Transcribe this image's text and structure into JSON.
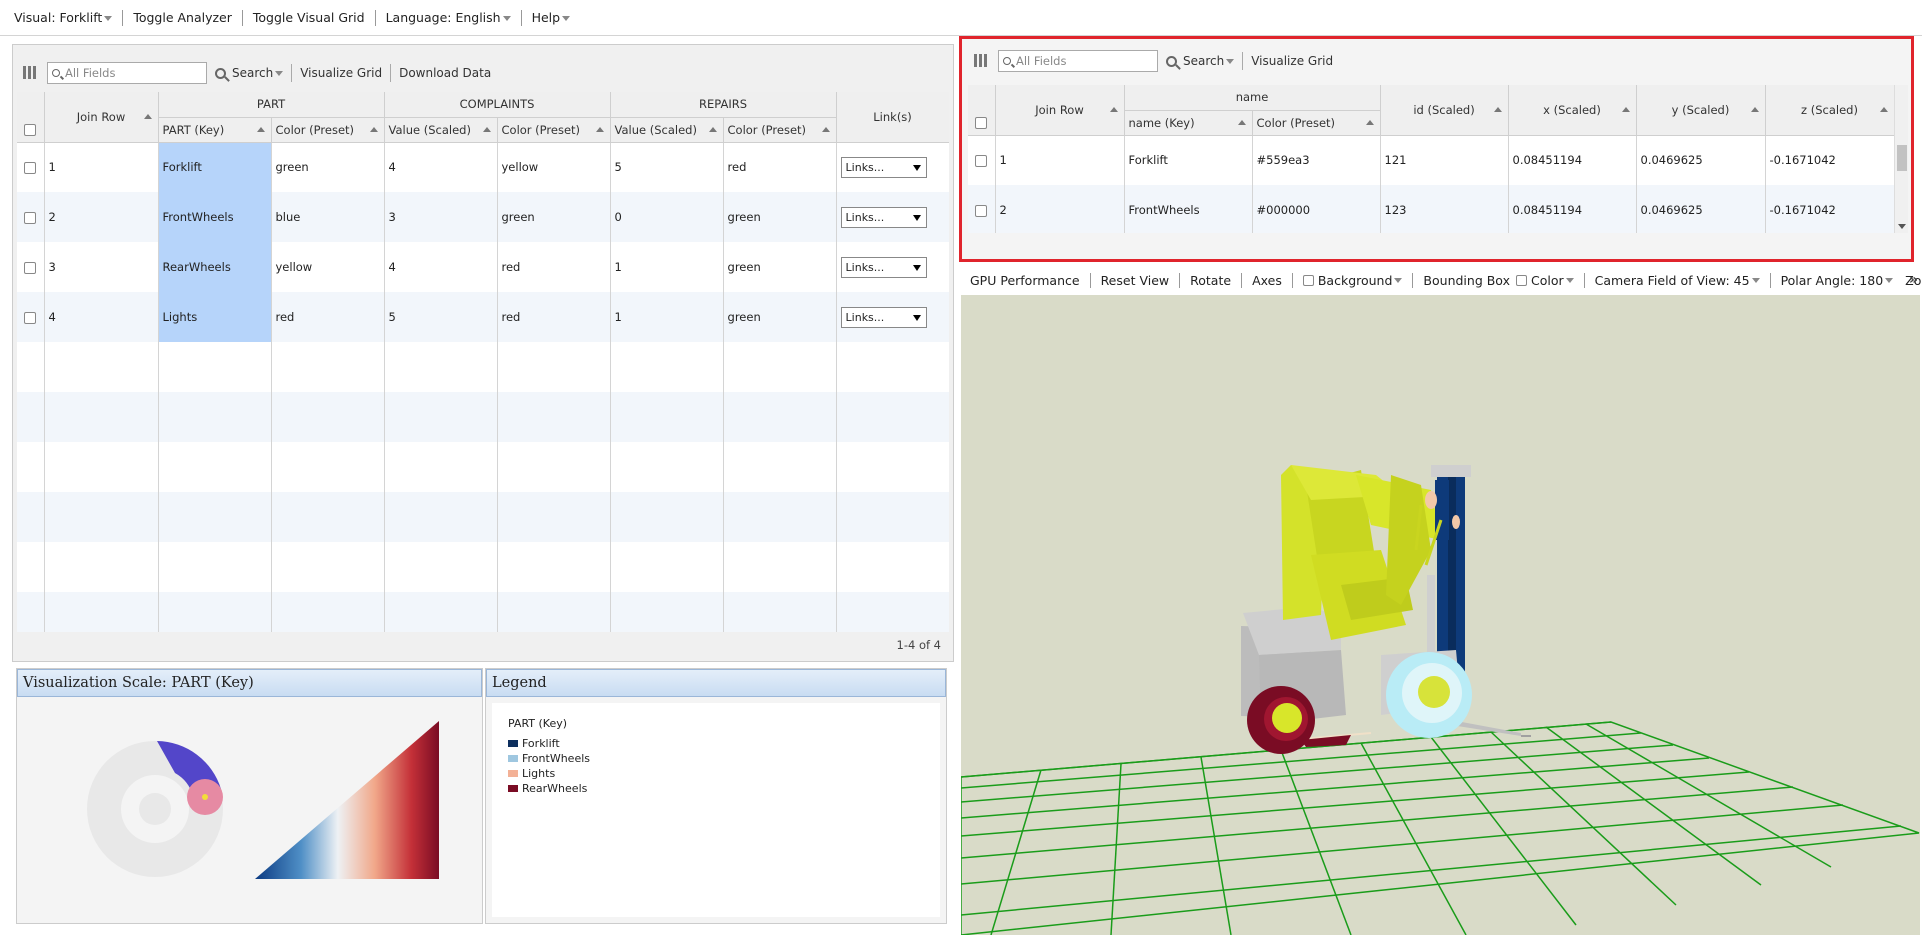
{
  "menubar": {
    "visual": "Visual: Forklift",
    "toggle_analyzer": "Toggle Analyzer",
    "toggle_grid": "Toggle Visual Grid",
    "language": "Language: English",
    "help": "Help"
  },
  "left_grid": {
    "search_placeholder": "All Fields",
    "search_label": "Search",
    "visualize_grid": "Visualize Grid",
    "download_data": "Download Data",
    "group_headers": {
      "part": "PART",
      "complaints": "COMPLAINTS",
      "repairs": "REPAIRS"
    },
    "columns": {
      "join_row": "Join Row",
      "part_key": "PART (Key)",
      "part_color": "Color (Preset)",
      "complaints_value": "Value (Scaled)",
      "complaints_color": "Color (Preset)",
      "repairs_value": "Value (Scaled)",
      "repairs_color": "Color (Preset)",
      "links": "Link(s)"
    },
    "rows": [
      {
        "join_row": "1",
        "part": "Forklift",
        "part_color": "green",
        "c_value": "4",
        "c_color": "yellow",
        "r_value": "5",
        "r_color": "red",
        "links": "Links..."
      },
      {
        "join_row": "2",
        "part": "FrontWheels",
        "part_color": "blue",
        "c_value": "3",
        "c_color": "green",
        "r_value": "0",
        "r_color": "green",
        "links": "Links..."
      },
      {
        "join_row": "3",
        "part": "RearWheels",
        "part_color": "yellow",
        "c_value": "4",
        "c_color": "red",
        "r_value": "1",
        "r_color": "green",
        "links": "Links..."
      },
      {
        "join_row": "4",
        "part": "Lights",
        "part_color": "red",
        "c_value": "5",
        "c_color": "red",
        "r_value": "1",
        "r_color": "green",
        "links": "Links..."
      }
    ],
    "pager": "1-4 of 4",
    "highlight_color": "#b6d4fa"
  },
  "scale_panel": {
    "title": "Visualization Scale: PART (Key)"
  },
  "legend_panel": {
    "title": "Legend",
    "heading": "PART (Key)",
    "items": [
      {
        "label": "Forklift",
        "color": "#0d2f5e"
      },
      {
        "label": "FrontWheels",
        "color": "#9fc7e0"
      },
      {
        "label": "Lights",
        "color": "#f3b196"
      },
      {
        "label": "RearWheels",
        "color": "#7a0c24"
      }
    ]
  },
  "right_grid": {
    "search_placeholder": "All Fields",
    "search_label": "Search",
    "visualize_grid": "Visualize Grid",
    "group_header": "name",
    "columns": {
      "join_row": "Join Row",
      "name_key": "name (Key)",
      "color": "Color (Preset)",
      "id": "id (Scaled)",
      "x": "x (Scaled)",
      "y": "y (Scaled)",
      "z": "z (Scaled)"
    },
    "rows": [
      {
        "join_row": "1",
        "name": "Forklift",
        "color": "#559ea3",
        "id": "121",
        "x": "0.08451194",
        "y": "0.0469625",
        "z": "-0.1671042"
      },
      {
        "join_row": "2",
        "name": "FrontWheels",
        "color": "#000000",
        "id": "123",
        "x": "0.08451194",
        "y": "0.0469625",
        "z": "-0.1671042"
      }
    ],
    "highlight_border": "#e0242c"
  },
  "viewer_toolbar": {
    "gpu": "GPU Performance",
    "reset": "Reset View",
    "rotate": "Rotate",
    "axes": "Axes",
    "background": "Background",
    "bbox": "Bounding Box",
    "color": "Color",
    "fov": "Camera Field of View: 45",
    "polar": "Polar Angle: 180",
    "zoom": "Zoom Speed:"
  },
  "viewer": {
    "background_color": "#d9dbc8",
    "grid_color": "#1a9c1a",
    "forklift_body": "#d8e62a",
    "mast_color": "#0e3a7a"
  }
}
